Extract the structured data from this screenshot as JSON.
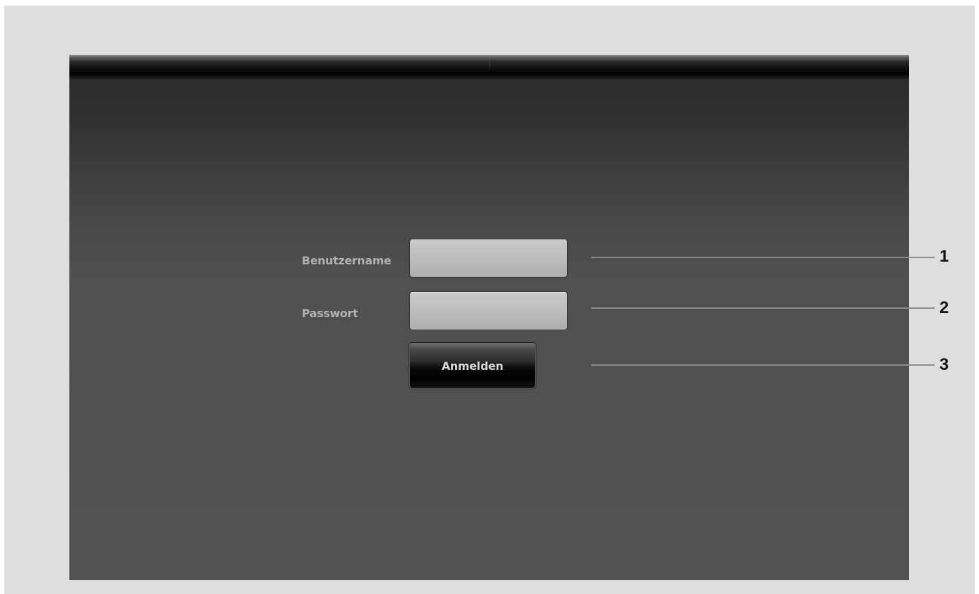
{
  "login_form": {
    "username_label": "Benutzername",
    "username_value": "",
    "password_label": "Passwort",
    "password_value": "",
    "login_button_label": "Anmelden"
  },
  "callouts": [
    {
      "number": "1"
    },
    {
      "number": "2"
    },
    {
      "number": "3"
    }
  ],
  "colors": {
    "page_background": "#dedede",
    "screen_background": "#525252",
    "title_bar": "#050505",
    "label_text": "#b2b2b2",
    "input_fill": "#bdbdbd",
    "button_fill": "#000000",
    "button_text": "#d8d8d8",
    "callout_line": "#8c8c8c",
    "callout_number": "#111111"
  }
}
